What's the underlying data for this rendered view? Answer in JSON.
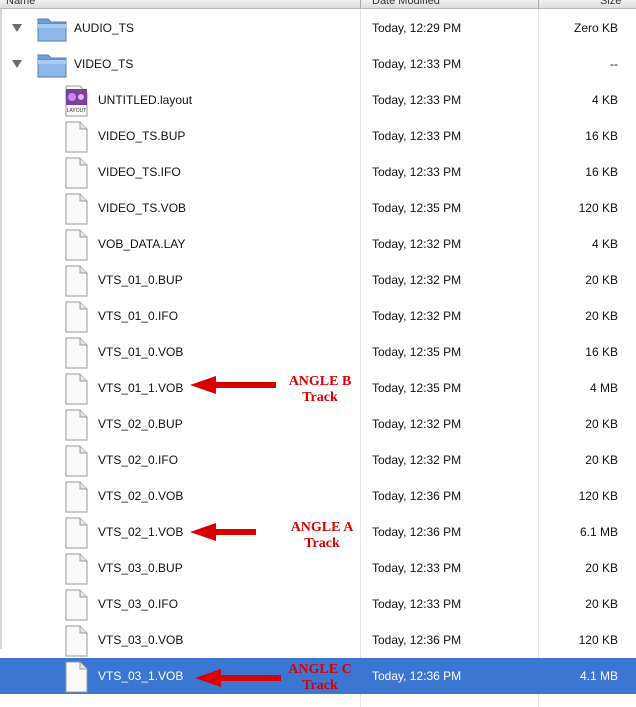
{
  "columns": {
    "name": "Name",
    "date": "Date Modified",
    "size": "Size"
  },
  "rows": [
    {
      "name": "AUDIO_TS",
      "date": "Today, 12:29 PM",
      "size": "Zero KB",
      "kind": "folder",
      "expanded": false
    },
    {
      "name": "VIDEO_TS",
      "date": "Today, 12:33 PM",
      "size": "--",
      "kind": "folder",
      "expanded": true
    },
    {
      "name": "UNTITLED.layout",
      "date": "Today, 12:33 PM",
      "size": "4 KB",
      "kind": "layout",
      "icon_text": "LAYOUT"
    },
    {
      "name": "VIDEO_TS.BUP",
      "date": "Today, 12:33 PM",
      "size": "16 KB",
      "kind": "doc"
    },
    {
      "name": "VIDEO_TS.IFO",
      "date": "Today, 12:33 PM",
      "size": "16 KB",
      "kind": "doc"
    },
    {
      "name": "VIDEO_TS.VOB",
      "date": "Today, 12:35 PM",
      "size": "120 KB",
      "kind": "doc"
    },
    {
      "name": "VOB_DATA.LAY",
      "date": "Today, 12:32 PM",
      "size": "4 KB",
      "kind": "doc"
    },
    {
      "name": "VTS_01_0.BUP",
      "date": "Today, 12:32 PM",
      "size": "20 KB",
      "kind": "doc"
    },
    {
      "name": "VTS_01_0.IFO",
      "date": "Today, 12:32 PM",
      "size": "20 KB",
      "kind": "doc"
    },
    {
      "name": "VTS_01_0.VOB",
      "date": "Today, 12:35 PM",
      "size": "16 KB",
      "kind": "doc"
    },
    {
      "name": "VTS_01_1.VOB",
      "date": "Today, 12:35 PM",
      "size": "4 MB",
      "kind": "doc"
    },
    {
      "name": "VTS_02_0.BUP",
      "date": "Today, 12:32 PM",
      "size": "20 KB",
      "kind": "doc"
    },
    {
      "name": "VTS_02_0.IFO",
      "date": "Today, 12:32 PM",
      "size": "20 KB",
      "kind": "doc"
    },
    {
      "name": "VTS_02_0.VOB",
      "date": "Today, 12:36 PM",
      "size": "120 KB",
      "kind": "doc"
    },
    {
      "name": "VTS_02_1.VOB",
      "date": "Today, 12:36 PM",
      "size": "6.1 MB",
      "kind": "doc"
    },
    {
      "name": "VTS_03_0.BUP",
      "date": "Today, 12:33 PM",
      "size": "20 KB",
      "kind": "doc"
    },
    {
      "name": "VTS_03_0.IFO",
      "date": "Today, 12:33 PM",
      "size": "20 KB",
      "kind": "doc"
    },
    {
      "name": "VTS_03_0.VOB",
      "date": "Today, 12:36 PM",
      "size": "120 KB",
      "kind": "doc"
    },
    {
      "name": "VTS_03_1.VOB",
      "date": "Today, 12:36 PM",
      "size": "4.1 MB",
      "kind": "doc",
      "selected": true
    }
  ],
  "annotations": {
    "angle_b": {
      "line1": "ANGLE B",
      "line2": "Track"
    },
    "angle_a": {
      "line1": "ANGLE A",
      "line2": "Track"
    },
    "angle_c": {
      "line1": "ANGLE C",
      "line2": "Track"
    }
  },
  "colors": {
    "selection": "#3b76d3",
    "annotation": "#d80000",
    "folder": "#7fa9d9"
  }
}
